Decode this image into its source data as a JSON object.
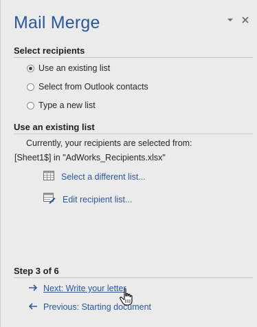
{
  "pane": {
    "title": "Mail Merge"
  },
  "select_recipients": {
    "heading": "Select recipients",
    "options": [
      {
        "label": "Use an existing list",
        "checked": true
      },
      {
        "label": "Select from Outlook contacts",
        "checked": false
      },
      {
        "label": "Type a new list",
        "checked": false
      }
    ]
  },
  "existing_list": {
    "heading": "Use an existing list",
    "line1": "Currently, your recipients are selected from:",
    "line2": "[Sheet1$] in \"AdWorks_Recipients.xlsx\"",
    "select_link": "Select a different list...",
    "edit_link": "Edit recipient list..."
  },
  "step": {
    "label": "Step 3 of 6",
    "next": "Next: Write your letter",
    "previous": "Previous: Starting document"
  },
  "colors": {
    "accent": "#2b579a",
    "background": "#ebebeb"
  }
}
